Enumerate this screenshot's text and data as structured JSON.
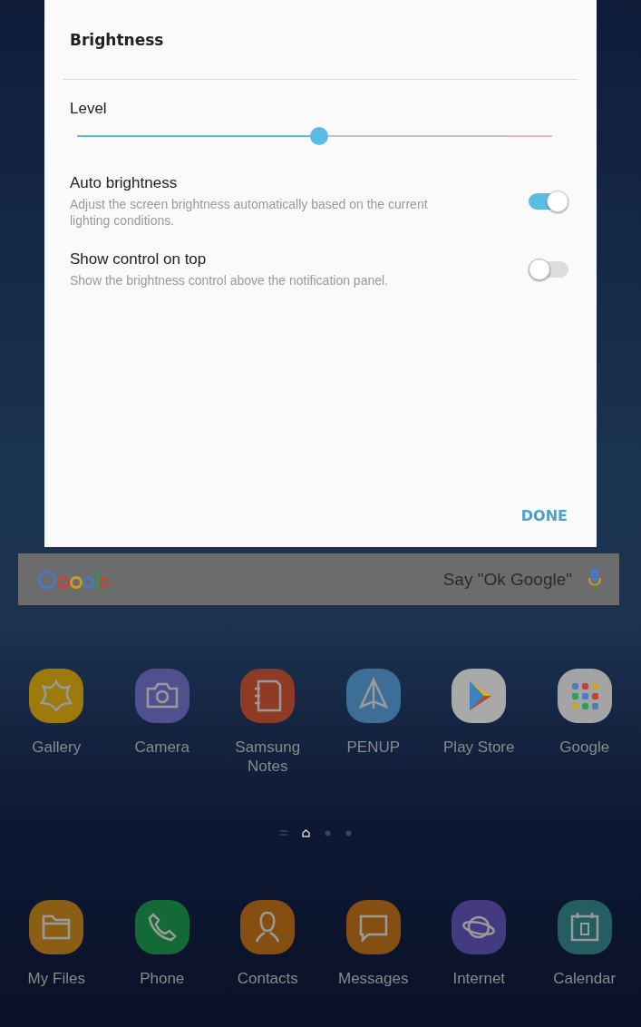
{
  "dialog": {
    "title": "Brightness",
    "level_label": "Level",
    "level": 0.51,
    "settings": [
      {
        "label": "Auto brightness",
        "description": "Adjust the screen brightness automatically based on the current lighting conditions.",
        "on": true
      },
      {
        "label": "Show control on top",
        "description": "Show the brightness control above the notification panel.",
        "on": false
      }
    ],
    "button": "DONE"
  },
  "search_bar": {
    "hint": "Say \"Ok Google\""
  },
  "apps": [
    {
      "name": "Gallery",
      "color": "#9c7a0c"
    },
    {
      "name": "Camera",
      "color": "#51508f"
    },
    {
      "name": "Samsung Notes",
      "color": "#8e3a24"
    },
    {
      "name": "PENUP",
      "color": "#3d6e98"
    },
    {
      "name": "Play Store",
      "color": "#a9a9a9"
    },
    {
      "name": "Google",
      "color": "#a4a4a4"
    }
  ],
  "page_indicator": [
    {
      "kind": "lines",
      "selected": false
    },
    {
      "kind": "home",
      "selected": true
    },
    {
      "kind": "dot",
      "selected": false
    },
    {
      "kind": "dot",
      "selected": false
    }
  ],
  "dock": [
    {
      "name": "My Files",
      "color": "#8a5e14"
    },
    {
      "name": "Phone",
      "color": "#146a36"
    },
    {
      "name": "Contacts",
      "color": "#844f10"
    },
    {
      "name": "Messages",
      "color": "#844f10"
    },
    {
      "name": "Internet",
      "color": "#433a80"
    },
    {
      "name": "Calendar",
      "color": "#245e60"
    }
  ]
}
